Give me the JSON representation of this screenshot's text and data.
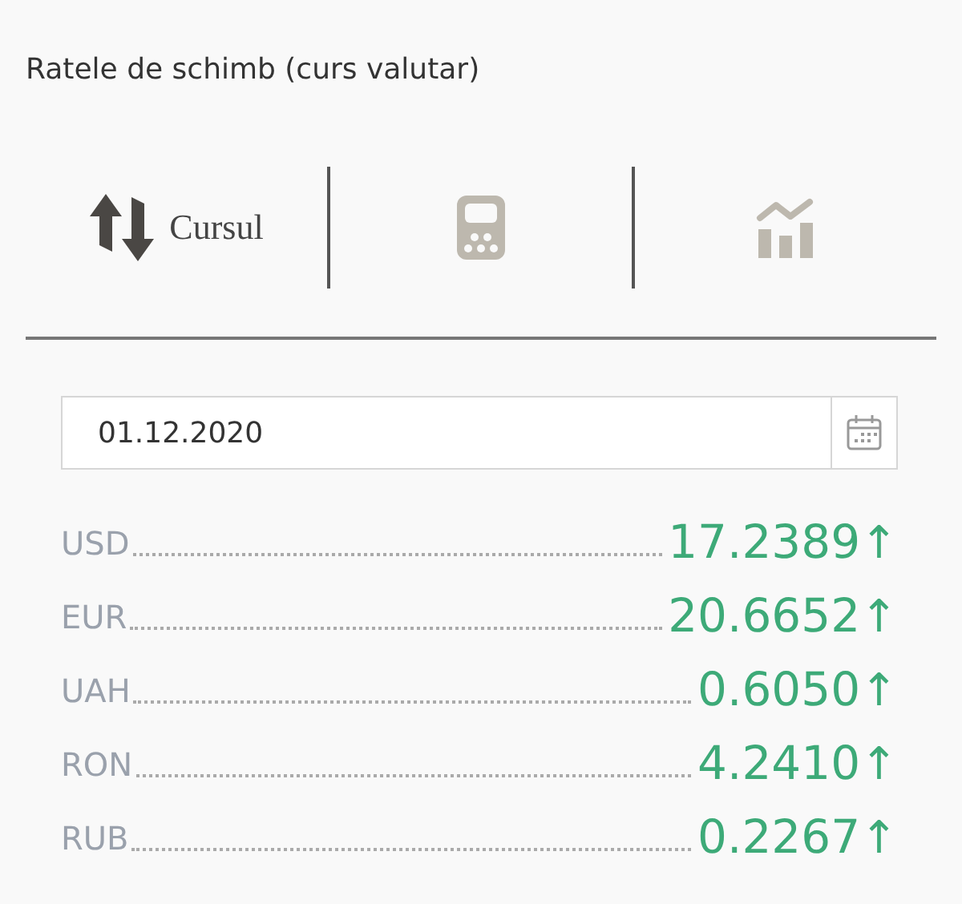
{
  "title": "Ratele de schimb (curs valutar)",
  "tabs": [
    {
      "kind": "rates",
      "label": "Cursul",
      "selected": true
    },
    {
      "kind": "calculator",
      "selected": false
    },
    {
      "kind": "chart",
      "selected": false
    }
  ],
  "date_field": {
    "value": "01.12.2020"
  },
  "rates": [
    {
      "currency": "USD",
      "value": "17.2389",
      "trend": "↑"
    },
    {
      "currency": "EUR",
      "value": "20.6652",
      "trend": "↑"
    },
    {
      "currency": "UAH",
      "value": "0.6050",
      "trend": "↑"
    },
    {
      "currency": "RON",
      "value": "4.2410",
      "trend": "↑"
    },
    {
      "currency": "RUB",
      "value": "0.2267",
      "trend": "↑"
    }
  ]
}
